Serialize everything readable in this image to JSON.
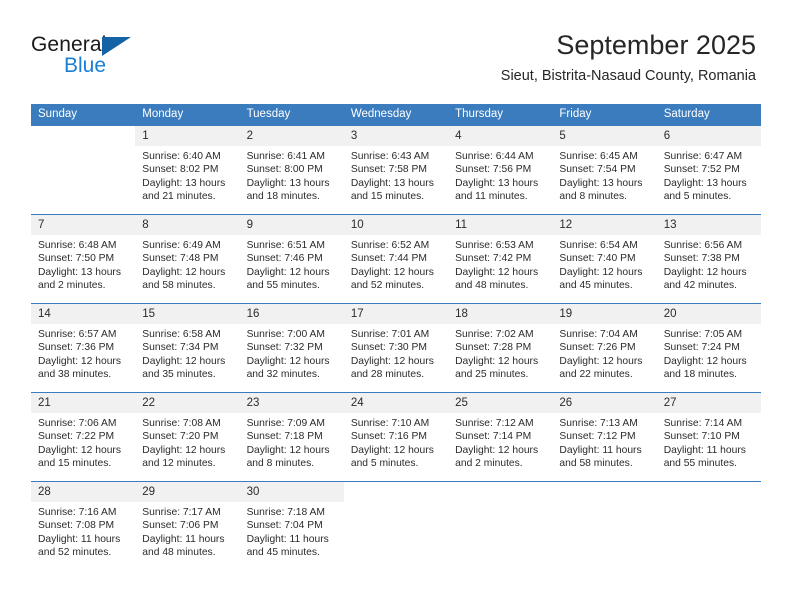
{
  "brand": {
    "name_part1": "General",
    "name_part2": "Blue",
    "logo_icon": "triangle-logo-icon"
  },
  "header": {
    "title": "September 2025",
    "subtitle": "Sieut, Bistrita-Nasaud County, Romania"
  },
  "colors": {
    "header_blue": "#3a7cbe",
    "brand_blue": "#1b7fd4",
    "logo_blue": "#1464a5",
    "daynum_bg": "#f1f1f1",
    "text": "#2b2b2b"
  },
  "calendar": {
    "weekday_headers": [
      "Sunday",
      "Monday",
      "Tuesday",
      "Wednesday",
      "Thursday",
      "Friday",
      "Saturday"
    ],
    "weeks": [
      [
        {
          "day": "",
          "sunrise": "",
          "sunset": "",
          "daylight1": "",
          "daylight2": ""
        },
        {
          "day": "1",
          "sunrise": "Sunrise: 6:40 AM",
          "sunset": "Sunset: 8:02 PM",
          "daylight1": "Daylight: 13 hours",
          "daylight2": "and 21 minutes."
        },
        {
          "day": "2",
          "sunrise": "Sunrise: 6:41 AM",
          "sunset": "Sunset: 8:00 PM",
          "daylight1": "Daylight: 13 hours",
          "daylight2": "and 18 minutes."
        },
        {
          "day": "3",
          "sunrise": "Sunrise: 6:43 AM",
          "sunset": "Sunset: 7:58 PM",
          "daylight1": "Daylight: 13 hours",
          "daylight2": "and 15 minutes."
        },
        {
          "day": "4",
          "sunrise": "Sunrise: 6:44 AM",
          "sunset": "Sunset: 7:56 PM",
          "daylight1": "Daylight: 13 hours",
          "daylight2": "and 11 minutes."
        },
        {
          "day": "5",
          "sunrise": "Sunrise: 6:45 AM",
          "sunset": "Sunset: 7:54 PM",
          "daylight1": "Daylight: 13 hours",
          "daylight2": "and 8 minutes."
        },
        {
          "day": "6",
          "sunrise": "Sunrise: 6:47 AM",
          "sunset": "Sunset: 7:52 PM",
          "daylight1": "Daylight: 13 hours",
          "daylight2": "and 5 minutes."
        }
      ],
      [
        {
          "day": "7",
          "sunrise": "Sunrise: 6:48 AM",
          "sunset": "Sunset: 7:50 PM",
          "daylight1": "Daylight: 13 hours",
          "daylight2": "and 2 minutes."
        },
        {
          "day": "8",
          "sunrise": "Sunrise: 6:49 AM",
          "sunset": "Sunset: 7:48 PM",
          "daylight1": "Daylight: 12 hours",
          "daylight2": "and 58 minutes."
        },
        {
          "day": "9",
          "sunrise": "Sunrise: 6:51 AM",
          "sunset": "Sunset: 7:46 PM",
          "daylight1": "Daylight: 12 hours",
          "daylight2": "and 55 minutes."
        },
        {
          "day": "10",
          "sunrise": "Sunrise: 6:52 AM",
          "sunset": "Sunset: 7:44 PM",
          "daylight1": "Daylight: 12 hours",
          "daylight2": "and 52 minutes."
        },
        {
          "day": "11",
          "sunrise": "Sunrise: 6:53 AM",
          "sunset": "Sunset: 7:42 PM",
          "daylight1": "Daylight: 12 hours",
          "daylight2": "and 48 minutes."
        },
        {
          "day": "12",
          "sunrise": "Sunrise: 6:54 AM",
          "sunset": "Sunset: 7:40 PM",
          "daylight1": "Daylight: 12 hours",
          "daylight2": "and 45 minutes."
        },
        {
          "day": "13",
          "sunrise": "Sunrise: 6:56 AM",
          "sunset": "Sunset: 7:38 PM",
          "daylight1": "Daylight: 12 hours",
          "daylight2": "and 42 minutes."
        }
      ],
      [
        {
          "day": "14",
          "sunrise": "Sunrise: 6:57 AM",
          "sunset": "Sunset: 7:36 PM",
          "daylight1": "Daylight: 12 hours",
          "daylight2": "and 38 minutes."
        },
        {
          "day": "15",
          "sunrise": "Sunrise: 6:58 AM",
          "sunset": "Sunset: 7:34 PM",
          "daylight1": "Daylight: 12 hours",
          "daylight2": "and 35 minutes."
        },
        {
          "day": "16",
          "sunrise": "Sunrise: 7:00 AM",
          "sunset": "Sunset: 7:32 PM",
          "daylight1": "Daylight: 12 hours",
          "daylight2": "and 32 minutes."
        },
        {
          "day": "17",
          "sunrise": "Sunrise: 7:01 AM",
          "sunset": "Sunset: 7:30 PM",
          "daylight1": "Daylight: 12 hours",
          "daylight2": "and 28 minutes."
        },
        {
          "day": "18",
          "sunrise": "Sunrise: 7:02 AM",
          "sunset": "Sunset: 7:28 PM",
          "daylight1": "Daylight: 12 hours",
          "daylight2": "and 25 minutes."
        },
        {
          "day": "19",
          "sunrise": "Sunrise: 7:04 AM",
          "sunset": "Sunset: 7:26 PM",
          "daylight1": "Daylight: 12 hours",
          "daylight2": "and 22 minutes."
        },
        {
          "day": "20",
          "sunrise": "Sunrise: 7:05 AM",
          "sunset": "Sunset: 7:24 PM",
          "daylight1": "Daylight: 12 hours",
          "daylight2": "and 18 minutes."
        }
      ],
      [
        {
          "day": "21",
          "sunrise": "Sunrise: 7:06 AM",
          "sunset": "Sunset: 7:22 PM",
          "daylight1": "Daylight: 12 hours",
          "daylight2": "and 15 minutes."
        },
        {
          "day": "22",
          "sunrise": "Sunrise: 7:08 AM",
          "sunset": "Sunset: 7:20 PM",
          "daylight1": "Daylight: 12 hours",
          "daylight2": "and 12 minutes."
        },
        {
          "day": "23",
          "sunrise": "Sunrise: 7:09 AM",
          "sunset": "Sunset: 7:18 PM",
          "daylight1": "Daylight: 12 hours",
          "daylight2": "and 8 minutes."
        },
        {
          "day": "24",
          "sunrise": "Sunrise: 7:10 AM",
          "sunset": "Sunset: 7:16 PM",
          "daylight1": "Daylight: 12 hours",
          "daylight2": "and 5 minutes."
        },
        {
          "day": "25",
          "sunrise": "Sunrise: 7:12 AM",
          "sunset": "Sunset: 7:14 PM",
          "daylight1": "Daylight: 12 hours",
          "daylight2": "and 2 minutes."
        },
        {
          "day": "26",
          "sunrise": "Sunrise: 7:13 AM",
          "sunset": "Sunset: 7:12 PM",
          "daylight1": "Daylight: 11 hours",
          "daylight2": "and 58 minutes."
        },
        {
          "day": "27",
          "sunrise": "Sunrise: 7:14 AM",
          "sunset": "Sunset: 7:10 PM",
          "daylight1": "Daylight: 11 hours",
          "daylight2": "and 55 minutes."
        }
      ],
      [
        {
          "day": "28",
          "sunrise": "Sunrise: 7:16 AM",
          "sunset": "Sunset: 7:08 PM",
          "daylight1": "Daylight: 11 hours",
          "daylight2": "and 52 minutes."
        },
        {
          "day": "29",
          "sunrise": "Sunrise: 7:17 AM",
          "sunset": "Sunset: 7:06 PM",
          "daylight1": "Daylight: 11 hours",
          "daylight2": "and 48 minutes."
        },
        {
          "day": "30",
          "sunrise": "Sunrise: 7:18 AM",
          "sunset": "Sunset: 7:04 PM",
          "daylight1": "Daylight: 11 hours",
          "daylight2": "and 45 minutes."
        },
        {
          "day": "",
          "sunrise": "",
          "sunset": "",
          "daylight1": "",
          "daylight2": ""
        },
        {
          "day": "",
          "sunrise": "",
          "sunset": "",
          "daylight1": "",
          "daylight2": ""
        },
        {
          "day": "",
          "sunrise": "",
          "sunset": "",
          "daylight1": "",
          "daylight2": ""
        },
        {
          "day": "",
          "sunrise": "",
          "sunset": "",
          "daylight1": "",
          "daylight2": ""
        }
      ]
    ]
  }
}
